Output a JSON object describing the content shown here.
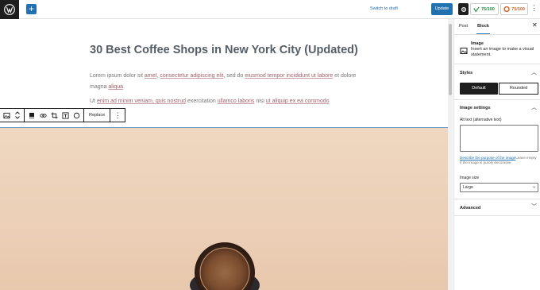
{
  "topbar": {
    "switch_draft": "Switch to draft",
    "update": "Update",
    "seo_score": "75/100",
    "readability_score": "75/100"
  },
  "post": {
    "title": "30 Best Coffee Shops in New York City (Updated)",
    "para1": {
      "t1": "Lorem ipsum dolor sit ",
      "l1": "amet",
      "t2": ", ",
      "l2": "consectetur adipiscing elit",
      "t3": ", sed do ",
      "l3": "eiusmod tempor incididunt ut labore",
      "t4": " et dolore magna ",
      "l4": "aliqua",
      "t5": "."
    },
    "para2": {
      "t1": "Ut ",
      "l1": "enim ad minim veniam, quis nostrud",
      "t2": " exercitation ",
      "l2": "ullamco laboris",
      "t3": " nisi ",
      "l3": "ut aliquip ex ea commodo"
    }
  },
  "toolbar": {
    "replace": "Replace",
    "icons": [
      "image-icon",
      "move-arrows-icon",
      "align-icon",
      "link-icon",
      "crop-icon",
      "text-overlay-icon",
      "circle-icon",
      "more-options-icon"
    ]
  },
  "sidebar": {
    "tabs": [
      "Post",
      "Block"
    ],
    "block_title": "Image",
    "block_desc": "Insert an image to make a visual statement.",
    "styles_heading": "Styles",
    "style_default": "Default",
    "style_rounded": "Rounded",
    "image_settings_heading": "Image settings",
    "alt_label": "Alt text (alternative text)",
    "alt_help_link": "Describe the purpose of the image",
    "alt_help_rest": "Leave empty if the image is purely decorative.",
    "image_size_label": "Image size",
    "image_size_value": "Large",
    "advanced_heading": "Advanced"
  },
  "colors": {
    "accent": "#2271b1",
    "seo_good": "#1e8c3a",
    "readability_ok": "#d4622a"
  }
}
